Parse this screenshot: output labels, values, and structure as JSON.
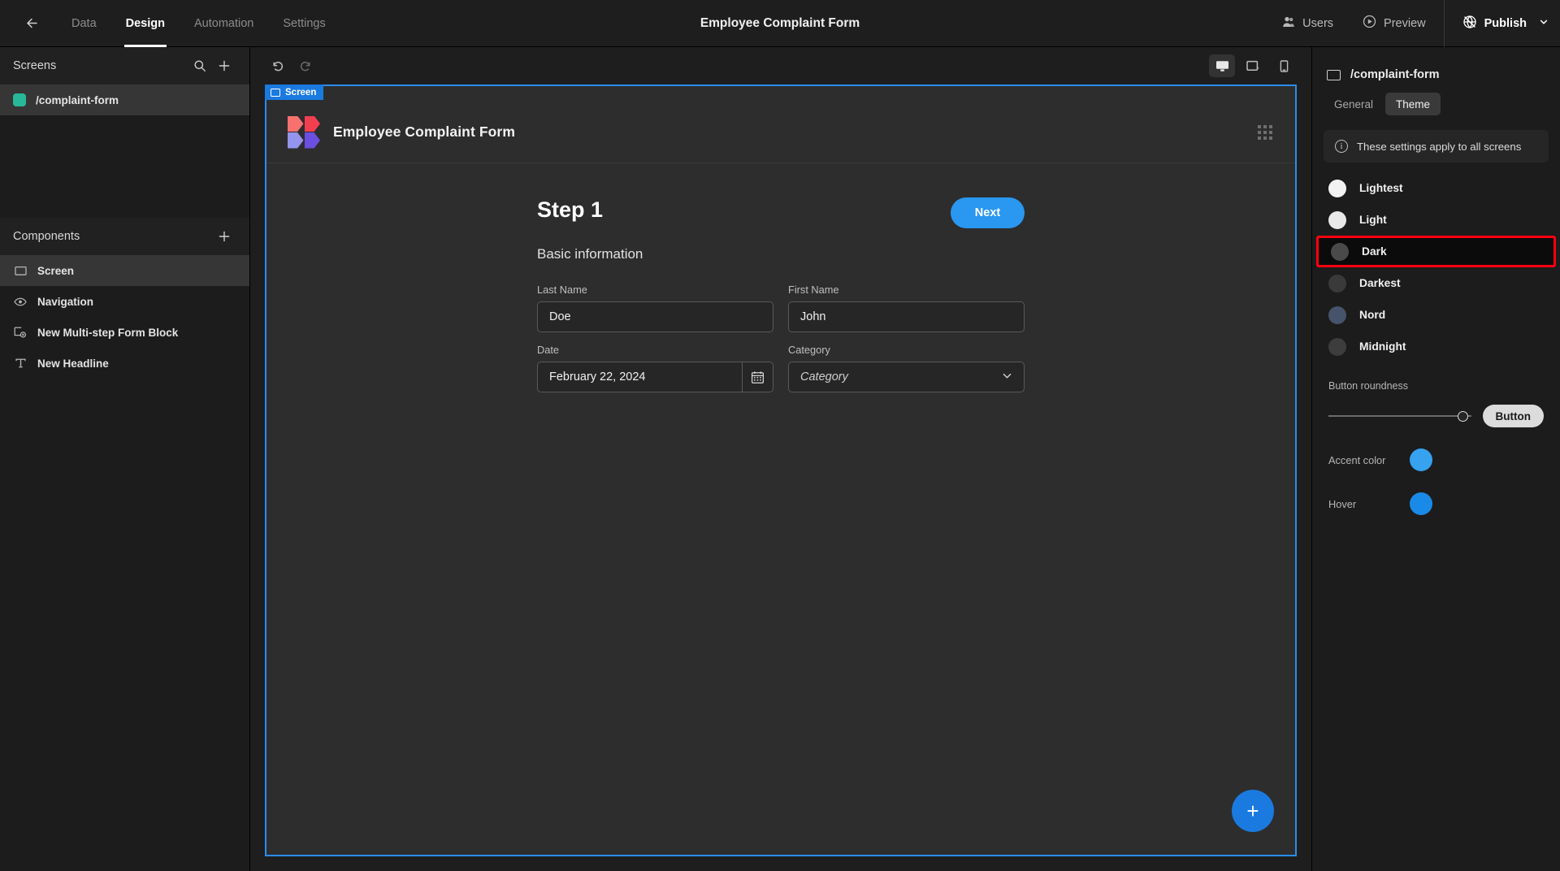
{
  "topbar": {
    "back_icon": "arrow-left-icon",
    "tabs": [
      {
        "label": "Data",
        "active": false
      },
      {
        "label": "Design",
        "active": true
      },
      {
        "label": "Automation",
        "active": false
      },
      {
        "label": "Settings",
        "active": false
      }
    ],
    "title": "Employee Complaint Form",
    "users_label": "Users",
    "preview_label": "Preview",
    "publish_label": "Publish"
  },
  "left_panel": {
    "screens_title": "Screens",
    "screens": [
      {
        "label": "/complaint-form",
        "color": "#27b799",
        "selected": true
      }
    ],
    "components_title": "Components",
    "components": [
      {
        "label": "Screen",
        "icon": "screen-icon",
        "selected": true
      },
      {
        "label": "Navigation",
        "icon": "eye-icon",
        "selected": false
      },
      {
        "label": "New Multi-step Form Block",
        "icon": "form-block-icon",
        "selected": false
      },
      {
        "label": "New Headline",
        "icon": "text-icon",
        "selected": false
      }
    ]
  },
  "canvas_toolbar": {
    "undo_icon": "undo-icon",
    "redo_icon": "redo-icon",
    "devices": [
      {
        "name": "desktop",
        "active": true
      },
      {
        "name": "tablet",
        "active": false
      },
      {
        "name": "mobile",
        "active": false
      }
    ]
  },
  "canvas": {
    "badge_label": "Screen",
    "app_title": "Employee Complaint Form",
    "logo_colors": [
      "#f97070",
      "#f23f4f",
      "#9494ef",
      "#6b4fe0"
    ],
    "step_title": "Step 1",
    "next_label": "Next",
    "subtitle": "Basic information",
    "fields": [
      [
        {
          "label": "Last Name",
          "value": "Doe",
          "type": "text"
        },
        {
          "label": "First Name",
          "value": "John",
          "type": "text"
        }
      ],
      [
        {
          "label": "Date",
          "value": "February 22, 2024",
          "type": "date"
        },
        {
          "label": "Category",
          "placeholder": "Category",
          "type": "select"
        }
      ]
    ],
    "fab_label": "+"
  },
  "right_panel": {
    "screen_name": "/complaint-form",
    "tabs": [
      {
        "label": "General",
        "active": false
      },
      {
        "label": "Theme",
        "active": true
      }
    ],
    "info_text": "These settings apply to all screens",
    "themes": [
      {
        "label": "Lightest",
        "color": "#f2f2f2",
        "highlighted": false
      },
      {
        "label": "Light",
        "color": "#e8e8e8",
        "highlighted": false
      },
      {
        "label": "Dark",
        "color": "#4a4a4a",
        "highlighted": true
      },
      {
        "label": "Darkest",
        "color": "#3a3a3a",
        "highlighted": false
      },
      {
        "label": "Nord",
        "color": "#46536b",
        "highlighted": false
      },
      {
        "label": "Midnight",
        "color": "#3d3d3d",
        "highlighted": false
      }
    ],
    "highlight_color": "#ff0011",
    "roundness_label": "Button roundness",
    "button_preview_label": "Button",
    "accent_label": "Accent color",
    "accent_color": "#36a2f0",
    "hover_label": "Hover",
    "hover_color": "#1a8ae8"
  }
}
